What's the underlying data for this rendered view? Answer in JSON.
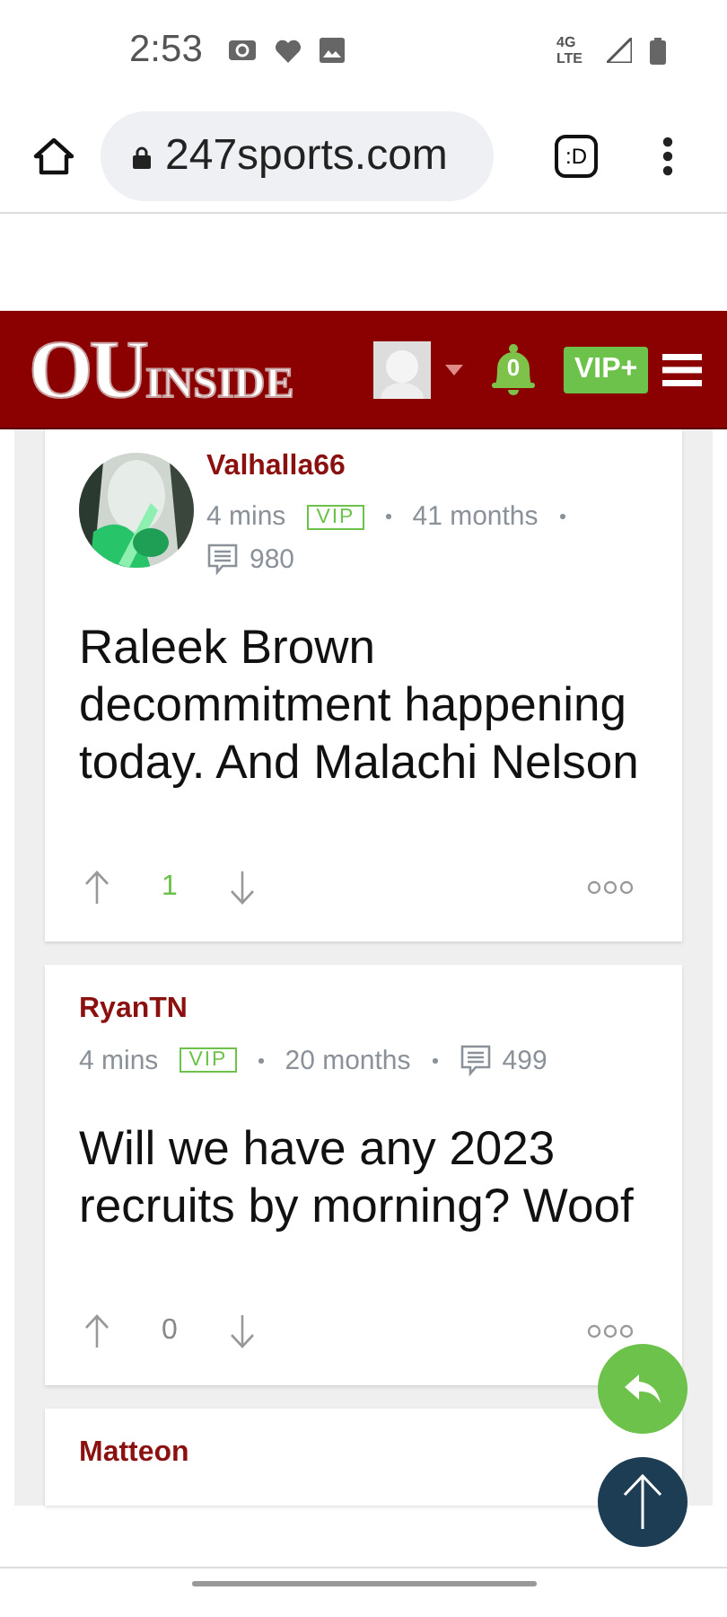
{
  "status_bar": {
    "time": "2:53",
    "network": "4G LTE"
  },
  "browser": {
    "url": "247sports.com",
    "tab_count": ":D"
  },
  "site_header": {
    "logo_main": "OU",
    "logo_sub": "INSIDE",
    "notifications": "0",
    "vip_button": "VIP+"
  },
  "posts": [
    {
      "author": "Valhalla66",
      "time": "4 mins",
      "badge": "VIP",
      "tenure": "41 months",
      "post_count": "980",
      "body": "Raleek Brown decommitment happening today. And Malachi Nelson",
      "score": "1",
      "upvoted": true
    },
    {
      "author": "RyanTN",
      "time": "4 mins",
      "badge": "VIP",
      "tenure": "20 months",
      "post_count": "499",
      "body": "Will we have any 2023 recruits by morning? Woof",
      "score": "0",
      "upvoted": false
    },
    {
      "author": "Matteon"
    }
  ]
}
